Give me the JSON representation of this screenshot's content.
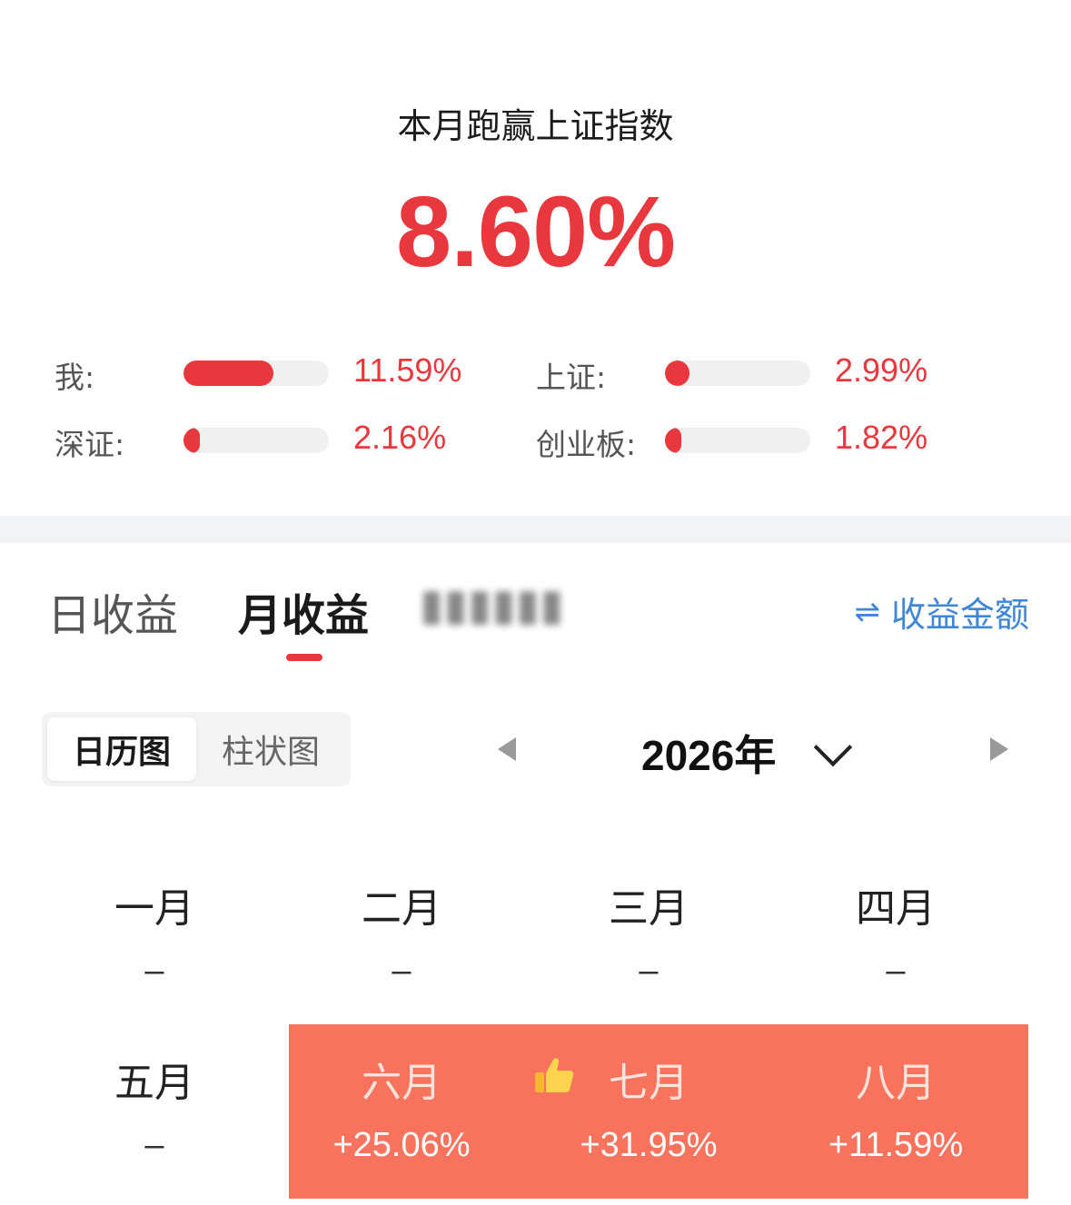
{
  "summary": {
    "title": "本月跑赢上证指数",
    "headline_value": "8.60%"
  },
  "comparisons": [
    {
      "label": "我:",
      "value": "11.59%",
      "fill_fraction": 0.62
    },
    {
      "label": "上证:",
      "value": "2.99%",
      "fill_fraction": 0.17
    },
    {
      "label": "深证:",
      "value": "2.16%",
      "fill_fraction": 0.11
    },
    {
      "label": "创业板:",
      "value": "1.82%",
      "fill_fraction": 0.1
    }
  ],
  "tabs": {
    "items": [
      "日收益",
      "月收益"
    ],
    "active": "月收益",
    "amount_toggle": "收益金额"
  },
  "view_toggle": {
    "options": [
      "日历图",
      "柱状图"
    ],
    "active": "日历图"
  },
  "year_nav": {
    "year_label": "2026年"
  },
  "months": [
    {
      "name": "一月",
      "value": "–"
    },
    {
      "name": "二月",
      "value": "–"
    },
    {
      "name": "三月",
      "value": "–"
    },
    {
      "name": "四月",
      "value": "–"
    },
    {
      "name": "五月",
      "value": "–"
    },
    {
      "name": "六月",
      "value": "+25.06%"
    },
    {
      "name": "七月",
      "value": "+31.95%",
      "best": true
    },
    {
      "name": "八月",
      "value": "+11.59%"
    }
  ],
  "colors": {
    "accent_red": "#e8373d",
    "highlight": "#f7735d",
    "link_blue": "#3f86d6"
  },
  "icons": [
    "swap-icon",
    "caret-left-icon",
    "caret-right-icon",
    "chevron-down-icon",
    "thumbs-up-icon"
  ]
}
